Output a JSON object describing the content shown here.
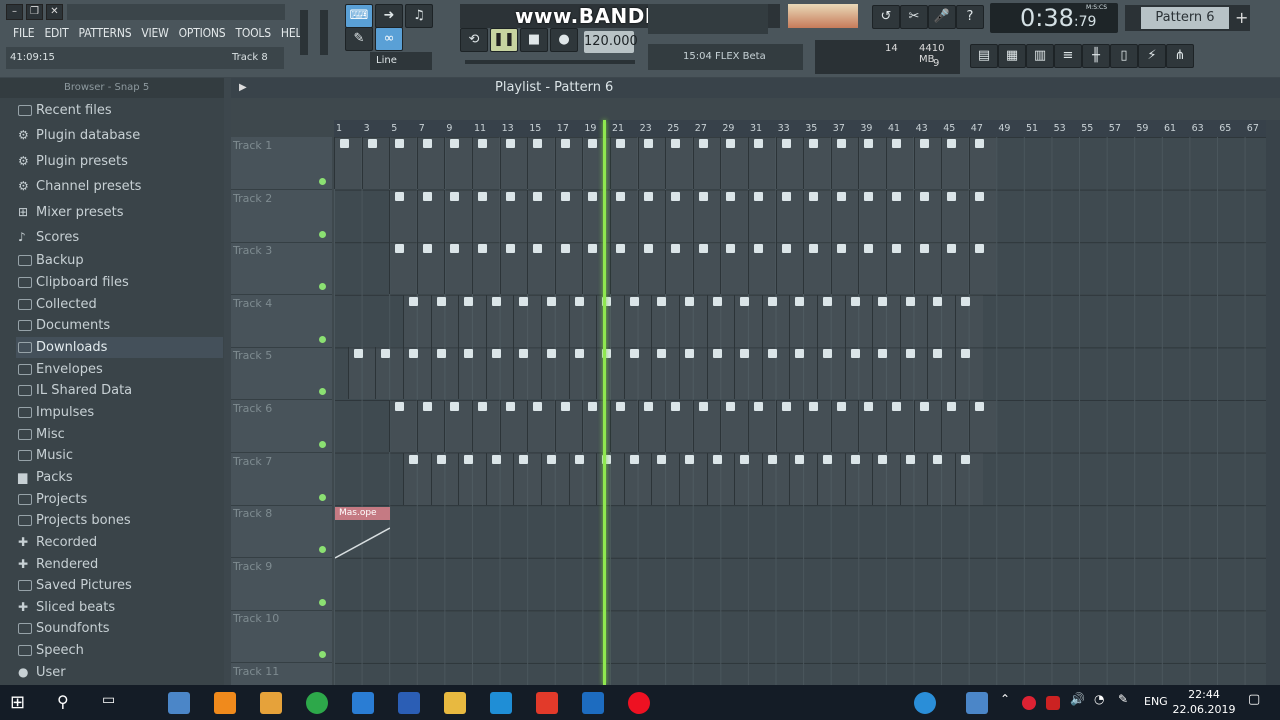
{
  "menu": [
    "FILE",
    "EDIT",
    "PATTERNS",
    "VIEW",
    "OPTIONS",
    "TOOLS",
    "HELP"
  ],
  "hint": {
    "time": "41:09:15",
    "track": "Track 8"
  },
  "transport": {
    "tempo": "120.000",
    "snap": "Line"
  },
  "time_display": {
    "main": "0:38",
    "sub": "79",
    "label": "M:S:CS"
  },
  "pattern": "Pattern 6",
  "watermark": "www.BANDICAM.com",
  "plugin_label": "15:04  FLEX Beta",
  "cpu": {
    "a": "14",
    "mem": "4410 MB",
    "voices": "9"
  },
  "browser": {
    "title": "Browser - Snap 5",
    "items": [
      {
        "label": "Recent files",
        "icon": "folder-icon"
      },
      {
        "label": "Plugin database",
        "icon": "plug-icon"
      },
      {
        "label": "Plugin presets",
        "icon": "plug-icon"
      },
      {
        "label": "Channel presets",
        "icon": "plug-icon"
      },
      {
        "label": "Mixer presets",
        "icon": "mixer-icon"
      },
      {
        "label": "Scores",
        "icon": "note-icon"
      },
      {
        "label": "Backup",
        "icon": "folder-icon"
      },
      {
        "label": "Clipboard files",
        "icon": "folder-icon"
      },
      {
        "label": "Collected",
        "icon": "folder-icon"
      },
      {
        "label": "Documents",
        "icon": "folder-icon"
      },
      {
        "label": "Downloads",
        "icon": "folder-icon",
        "selected": true
      },
      {
        "label": "Envelopes",
        "icon": "folder-icon"
      },
      {
        "label": "IL Shared Data",
        "icon": "folder-icon"
      },
      {
        "label": "Impulses",
        "icon": "folder-icon"
      },
      {
        "label": "Misc",
        "icon": "folder-icon"
      },
      {
        "label": "Music",
        "icon": "folder-icon"
      },
      {
        "label": "Packs",
        "icon": "pack-icon"
      },
      {
        "label": "Projects",
        "icon": "folder-icon"
      },
      {
        "label": "Projects bones",
        "icon": "folder-icon"
      },
      {
        "label": "Recorded",
        "icon": "plus-icon"
      },
      {
        "label": "Rendered",
        "icon": "plus-icon"
      },
      {
        "label": "Saved Pictures",
        "icon": "folder-icon"
      },
      {
        "label": "Sliced beats",
        "icon": "plus-icon"
      },
      {
        "label": "Soundfonts",
        "icon": "folder-icon"
      },
      {
        "label": "Speech",
        "icon": "folder-icon"
      },
      {
        "label": "User",
        "icon": "user-icon"
      }
    ]
  },
  "playlist": {
    "title": "Playlist - Pattern 6",
    "ruler": [
      "1",
      "3",
      "5",
      "7",
      "9",
      "11",
      "13",
      "15",
      "17",
      "19",
      "21",
      "23",
      "25",
      "27",
      "29",
      "31",
      "33",
      "35",
      "37",
      "39",
      "41",
      "43",
      "45",
      "47",
      "49",
      "51",
      "53",
      "55",
      "57",
      "59",
      "61",
      "63",
      "65",
      "67"
    ],
    "tracks": [
      "Track 1",
      "Track 2",
      "Track 3",
      "Track 4",
      "Track 5",
      "Track 6",
      "Track 7",
      "Track 8",
      "Track 9",
      "Track 10",
      "Track 11"
    ],
    "automation_clip": "Mas.ope"
  },
  "taskbar": {
    "lang": "ENG",
    "time": "22:44",
    "date": "22.06.2019"
  }
}
